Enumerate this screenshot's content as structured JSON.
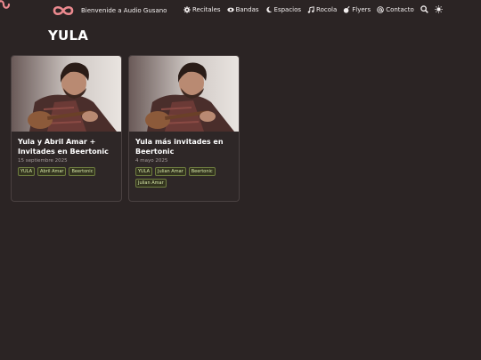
{
  "brand": {
    "text": "Bienvenide a Audio Gusano",
    "logo_color": "#ec8a8f"
  },
  "nav": {
    "items": [
      {
        "label": "Recitales",
        "icon": "gear-icon"
      },
      {
        "label": "Bandas",
        "icon": "eye-icon"
      },
      {
        "label": "Espacios",
        "icon": "moon-icon"
      },
      {
        "label": "Rocola",
        "icon": "music-note-icon"
      },
      {
        "label": "Flyers",
        "icon": "bomb-icon"
      },
      {
        "label": "Contacto",
        "icon": "at-sign-icon"
      }
    ],
    "tools": [
      "search-icon",
      "theme-toggle-icon"
    ]
  },
  "page": {
    "title": "YULA"
  },
  "cards": [
    {
      "title": "Yula y Abril Amar + Invitades en Beertonic",
      "date": "15 septiembre 2025",
      "tags": [
        "YULA",
        "Abril Amar",
        "Beertonic"
      ]
    },
    {
      "title": "Yula más invitades en Beertonic",
      "date": "4 mayo 2025",
      "tags": [
        "YULA",
        "Julian Amar",
        "Beertonic",
        "Julian Amar"
      ]
    }
  ],
  "colors": {
    "background": "#2b2424",
    "tag_border": "#6e7c3f",
    "tag_text": "#d7e8a8"
  }
}
